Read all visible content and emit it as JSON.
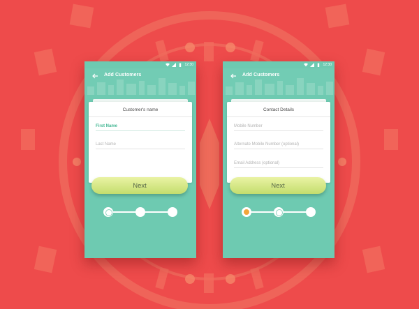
{
  "screens": [
    {
      "status_time": "12:30",
      "app_title": "Add Customers",
      "card_title": "Customer's name",
      "fields": [
        {
          "label": "First Name",
          "active": true
        },
        {
          "label": "Last Name",
          "active": false
        }
      ],
      "next_label": "Next",
      "stepper": {
        "current_step": 1,
        "total_steps": 3
      }
    },
    {
      "status_time": "12:30",
      "app_title": "Add Customers",
      "card_title": "Contact Details",
      "fields": [
        {
          "label": "Mobile Number",
          "active": false
        },
        {
          "label": "Alternate Mobile Number (optional)",
          "active": false
        },
        {
          "label": "Email Address (optional)",
          "active": false
        }
      ],
      "next_label": "Next",
      "stepper": {
        "current_step": 2,
        "total_steps": 3
      }
    }
  ],
  "colors": {
    "background": "#ee4b4b",
    "phone_teal": "#6ecab1",
    "button_lime": "#c3dd6d",
    "accent_green": "#46b895",
    "step_done_orange": "#f4a63a"
  },
  "icons": [
    "back-arrow-icon",
    "wifi-icon",
    "signal-icon",
    "battery-icon"
  ]
}
